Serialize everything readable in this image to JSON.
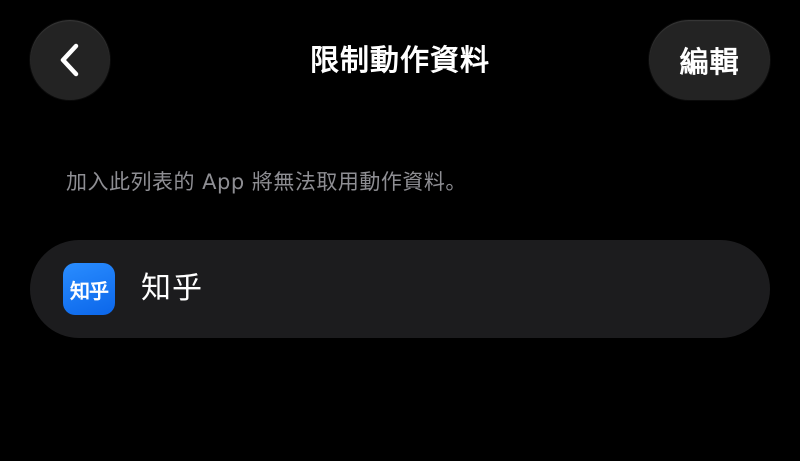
{
  "nav": {
    "title": "限制動作資料",
    "back_icon": "chevron-left-icon",
    "edit_label": "編輯"
  },
  "description": "加入此列表的 App 將無法取用動作資料。",
  "apps": [
    {
      "name": "知乎",
      "icon_text": "知乎",
      "icon_color": "#1a7bf5"
    }
  ],
  "colors": {
    "background": "#000000",
    "button_background": "#232323",
    "list_background": "#1c1c1e",
    "secondary_text": "#8e8e93"
  }
}
